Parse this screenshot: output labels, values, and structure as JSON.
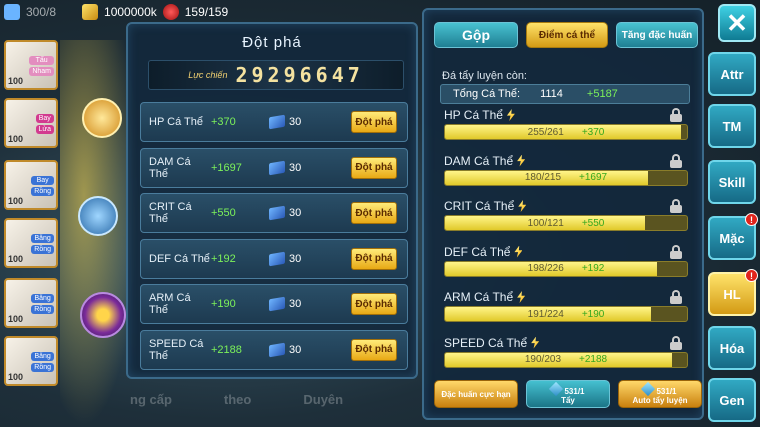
{
  "currency": {
    "gold": "1000000k",
    "potions": "159/159",
    "energy": "300/8"
  },
  "hero_cards": [
    {
      "lv": "100",
      "tags": [
        "Tấu",
        "Nham"
      ],
      "tag_colors": [
        "#e38dbf",
        "#e38dbf"
      ]
    },
    {
      "lv": "100",
      "tags": [
        "Bay",
        "Lửa"
      ],
      "tag_colors": [
        "#d23a8f",
        "#d23a8f"
      ]
    },
    {
      "lv": "100",
      "tags": [
        "Bay",
        "Rồng"
      ],
      "tag_colors": [
        "#3a73d6",
        "#3a73d6"
      ]
    },
    {
      "lv": "100",
      "tags": [
        "Băng",
        "Rồng"
      ],
      "tag_colors": [
        "#3a73d6",
        "#3a73d6"
      ]
    },
    {
      "lv": "100",
      "tags": [
        "Băng",
        "Rồng"
      ],
      "tag_colors": [
        "#3a73d6",
        "#3a73d6"
      ]
    },
    {
      "lv": "100",
      "tags": [
        "Băng",
        "Rồng"
      ],
      "tag_colors": [
        "#3a73d6",
        "#3a73d6"
      ]
    }
  ],
  "ghost_tabs": [
    "ng cấp",
    "theo",
    "Duyên"
  ],
  "breakthrough": {
    "title": "Đột phá",
    "power_label": "Lực chiến",
    "power_value": "29296647",
    "rows": [
      {
        "name": "HP Cá Thể",
        "plus": "+370",
        "count": "30",
        "button": "Đột phá"
      },
      {
        "name": "DAM Cá Thể",
        "plus": "+1697",
        "count": "30",
        "button": "Đột phá"
      },
      {
        "name": "CRIT Cá Thể",
        "plus": "+550",
        "count": "30",
        "button": "Đột phá"
      },
      {
        "name": "DEF Cá Thể",
        "plus": "+192",
        "count": "30",
        "button": "Đột phá"
      },
      {
        "name": "ARM Cá Thể",
        "plus": "+190",
        "count": "30",
        "button": "Đột phá"
      },
      {
        "name": "SPEED Cá Thể",
        "plus": "+2188",
        "count": "30",
        "button": "Đột phá"
      }
    ]
  },
  "individual": {
    "tabs": [
      "Gộp",
      "Điểm cá thể",
      "Tăng đặc huấn"
    ],
    "subtitle": "Đá tẩy luyện còn:",
    "total_label": "Tổng Cá Thể:",
    "total_value": "1114",
    "total_plus": "+5187",
    "stats": [
      {
        "name": "HP Cá Thể",
        "cur": 255,
        "max": 261,
        "value": "255/261",
        "plus": "+370"
      },
      {
        "name": "DAM Cá Thể",
        "cur": 180,
        "max": 215,
        "value": "180/215",
        "plus": "+1697"
      },
      {
        "name": "CRIT Cá Thể",
        "cur": 100,
        "max": 121,
        "value": "100/121",
        "plus": "+550"
      },
      {
        "name": "DEF Cá Thể",
        "cur": 198,
        "max": 226,
        "value": "198/226",
        "plus": "+192"
      },
      {
        "name": "ARM Cá Thể",
        "cur": 191,
        "max": 224,
        "value": "191/224",
        "plus": "+190"
      },
      {
        "name": "SPEED Cá Thể",
        "cur": 190,
        "max": 203,
        "value": "190/203",
        "plus": "+2188"
      }
    ],
    "bottom_buttons": [
      {
        "label": "Đặc huấn cực hạn",
        "count": ""
      },
      {
        "label": "Tẩy",
        "count": "531/1"
      },
      {
        "label": "Auto tẩy luyện",
        "count": "531/1"
      }
    ]
  },
  "side_tabs": [
    {
      "label": "Attr",
      "badge": ""
    },
    {
      "label": "TM",
      "badge": ""
    },
    {
      "label": "Skill",
      "badge": ""
    },
    {
      "label": "Mặc",
      "badge": "!"
    },
    {
      "label": "HL",
      "badge": "!"
    },
    {
      "label": "Hóa",
      "badge": ""
    },
    {
      "label": "Gen",
      "badge": ""
    }
  ],
  "close_label": "✕",
  "colors": {
    "gold": "#e8a915",
    "teal": "#31a9c3",
    "green_plus": "#7cf15a"
  }
}
